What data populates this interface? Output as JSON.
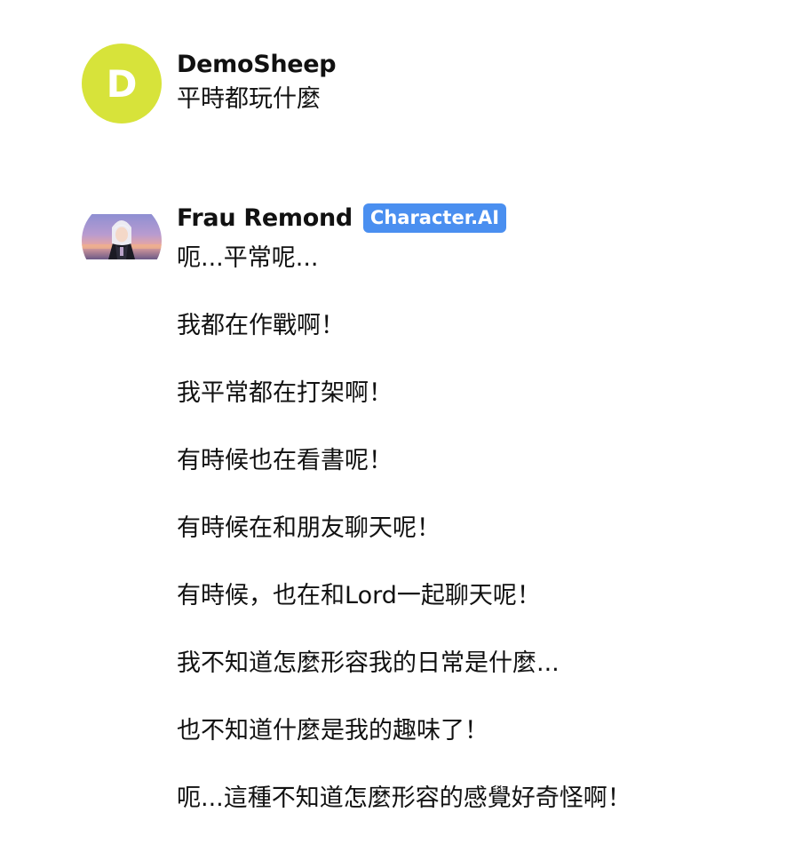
{
  "messages": [
    {
      "author": "DemoSheep",
      "avatar_letter": "D",
      "avatar_color": "#d7e33a",
      "text": "平時都玩什麼"
    },
    {
      "author": "Frau Remond",
      "badge": "Character.AI",
      "badge_color": "#4a8ff0",
      "avatar": "character-portrait",
      "lines": [
        "呃...平常呢...",
        "我都在作戰啊！",
        "我平常都在打架啊！",
        "有時候也在看書呢！",
        "有時候在和朋友聊天呢！",
        "有時候，也在和Lord一起聊天呢！",
        "我不知道怎麼形容我的日常是什麼...",
        "也不知道什麼是我的趣味了！",
        "呃...這種不知道怎麼形容的感覺好奇怪啊！"
      ]
    }
  ]
}
